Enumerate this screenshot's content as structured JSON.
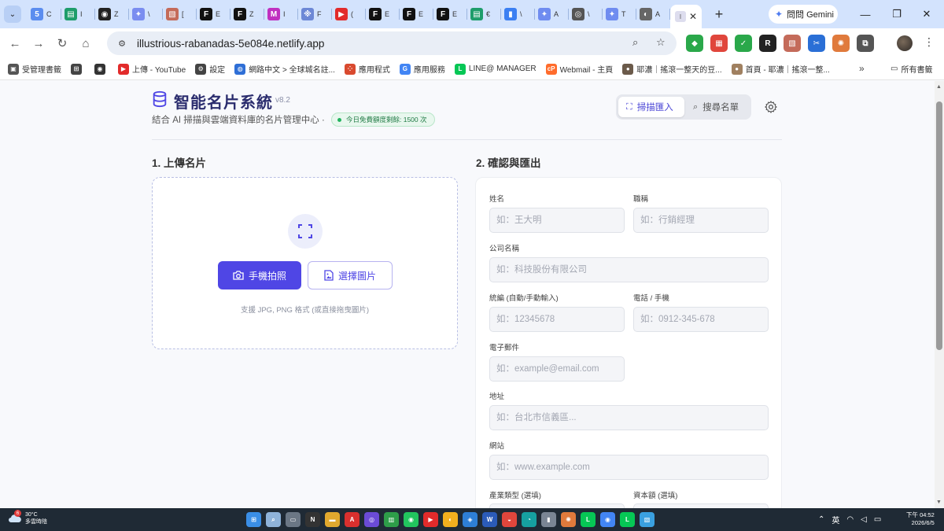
{
  "browser": {
    "mini_tabs": [
      {
        "fav": "5",
        "color": "#5b8def",
        "title": "C"
      },
      {
        "fav": "▤",
        "color": "#1e9d6b",
        "title": "I"
      },
      {
        "fav": "◉",
        "color": "#222222",
        "title": "Z"
      },
      {
        "fav": "✦",
        "color": "#7a8df0",
        "title": "\\"
      },
      {
        "fav": "▧",
        "color": "#c46b5a",
        "title": "["
      },
      {
        "fav": "F",
        "color": "#111111",
        "title": "E"
      },
      {
        "fav": "F",
        "color": "#111111",
        "title": "Z"
      },
      {
        "fav": "M",
        "color": "#c030c0",
        "title": "I"
      },
      {
        "fav": "※",
        "color": "#6d88d6",
        "title": "F"
      },
      {
        "fav": "▶",
        "color": "#e22b2b",
        "title": "("
      },
      {
        "fav": "F",
        "color": "#111111",
        "title": "E"
      },
      {
        "fav": "F",
        "color": "#111111",
        "title": "E"
      },
      {
        "fav": "F",
        "color": "#111111",
        "title": "E"
      },
      {
        "fav": "▤",
        "color": "#1e9d6b",
        "title": "€"
      },
      {
        "fav": "▮",
        "color": "#3b7ff2",
        "title": "\\"
      },
      {
        "fav": "✦",
        "color": "#6f8cf0",
        "title": "A"
      },
      {
        "fav": "◎",
        "color": "#555555",
        "title": "\\"
      },
      {
        "fav": "✦",
        "color": "#6f8cf0",
        "title": "T"
      },
      {
        "fav": "◐",
        "color": "#666666",
        "title": "A"
      }
    ],
    "active_tab_title": "I",
    "gemini_label": "問問 Gemini",
    "url": "illustrious-rabanadas-5e084e.netlify.app",
    "extensions": [
      {
        "glyph": "◆",
        "color": "#2aa84a"
      },
      {
        "glyph": "▦",
        "color": "#e0463c"
      },
      {
        "glyph": "✓",
        "color": "#2aa84a"
      },
      {
        "glyph": "R",
        "color": "#222222"
      },
      {
        "glyph": "▧",
        "color": "#c46b5a"
      },
      {
        "glyph": "✂",
        "color": "#2a6fd6"
      },
      {
        "glyph": "✺",
        "color": "#e07a3c"
      },
      {
        "glyph": "⧉",
        "color": "#555555"
      }
    ],
    "bookmarks": [
      {
        "label": "受管理書籤",
        "glyph": "▣",
        "color": "#555555"
      },
      {
        "label": "",
        "glyph": "⊞",
        "color": "#444444"
      },
      {
        "label": "",
        "glyph": "◉",
        "color": "#333333"
      },
      {
        "label": "上傳 - YouTube",
        "glyph": "▶",
        "color": "#e22b2b"
      },
      {
        "label": "設定",
        "glyph": "⚙",
        "color": "#444444"
      },
      {
        "label": "網路中文 > 全球城名註...",
        "glyph": "◍",
        "color": "#2f6fd6"
      },
      {
        "label": "應用程式",
        "glyph": "⁘",
        "color": "#d94a2f"
      },
      {
        "label": "應用服務",
        "glyph": "G",
        "color": "#4285f4"
      },
      {
        "label": "LINE@ MANAGER",
        "glyph": "L",
        "color": "#06c755"
      },
      {
        "label": "Webmail - 主頁",
        "glyph": "cP",
        "color": "#ff6c2c"
      },
      {
        "label": "耶濃｜搖滾一整天的豆...",
        "glyph": "●",
        "color": "#6b5a4a"
      },
      {
        "label": "首頁 - 耶濃｜搖滾一整...",
        "glyph": "●",
        "color": "#a08060"
      }
    ],
    "all_bookmarks": "所有書籤"
  },
  "app": {
    "title": "智能名片系統",
    "version": "v8.2",
    "subtitle": "結合 AI 掃描與雲端資料庫的名片管理中心 ·",
    "quota": "今日免費額度剩餘: 1500 次",
    "tabs": {
      "scan": "掃描匯入",
      "search": "搜尋名單"
    },
    "accent": "#4f46e5"
  },
  "upload": {
    "section_title": "1. 上傳名片",
    "camera_button": "手機拍照",
    "pick_button": "選擇圖片",
    "hint": "支援 JPG, PNG 格式 (或直接拖曳圖片)"
  },
  "form": {
    "section_title": "2. 確認與匯出",
    "fields": {
      "name": {
        "label": "姓名",
        "placeholder": "如：王大明",
        "value": ""
      },
      "job_title": {
        "label": "職稱",
        "placeholder": "如：行銷經理",
        "value": ""
      },
      "company": {
        "label": "公司名稱",
        "placeholder": "如：科技股份有限公司",
        "value": ""
      },
      "tax_id": {
        "label": "統編 (自動/手動輸入)",
        "placeholder": "如：12345678",
        "value": ""
      },
      "phone": {
        "label": "電話 / 手機",
        "placeholder": "如：0912-345-678",
        "value": ""
      },
      "email": {
        "label": "電子郵件",
        "placeholder": "如：example@email.com",
        "value": ""
      },
      "address": {
        "label": "地址",
        "placeholder": "如：台北市信義區...",
        "value": ""
      },
      "website": {
        "label": "網站",
        "placeholder": "如：www.example.com",
        "value": ""
      },
      "industry": {
        "label": "產業類型 (選填)",
        "placeholder": "",
        "value": ""
      },
      "capital": {
        "label": "資本額 (選填)",
        "placeholder": "",
        "value": ""
      }
    }
  },
  "taskbar": {
    "weather_badge": "6",
    "temperature": "30°C",
    "weather_text": "多雲時陰",
    "ime": "英",
    "time": "下午 04:52",
    "date": "2026/6/5",
    "apps": [
      {
        "glyph": "⊞",
        "color": "#3a8ee6"
      },
      {
        "glyph": "⌕",
        "color": "#8fb3d9"
      },
      {
        "glyph": "▭",
        "color": "#6b7785"
      },
      {
        "glyph": "N",
        "color": "#333333"
      },
      {
        "glyph": "▬",
        "color": "#e0a82e"
      },
      {
        "glyph": "A",
        "color": "#d9302e"
      },
      {
        "glyph": "◎",
        "color": "#6b4bd6"
      },
      {
        "glyph": "▥",
        "color": "#2e9d49"
      },
      {
        "glyph": "◉",
        "color": "#22c55e"
      },
      {
        "glyph": "▶",
        "color": "#e22b2b"
      },
      {
        "glyph": "◐",
        "color": "#f2b01e"
      },
      {
        "glyph": "◈",
        "color": "#2e7fd6"
      },
      {
        "glyph": "W",
        "color": "#2b5bb8"
      },
      {
        "glyph": "◒",
        "color": "#e0463c"
      },
      {
        "glyph": "◔",
        "color": "#16a0a0"
      },
      {
        "glyph": "▮",
        "color": "#7a8594"
      },
      {
        "glyph": "✺",
        "color": "#e07a3c"
      },
      {
        "glyph": "L",
        "color": "#06c755"
      },
      {
        "glyph": "◉",
        "color": "#4285f4"
      },
      {
        "glyph": "L",
        "color": "#06c755"
      },
      {
        "glyph": "▧",
        "color": "#3aa0e0"
      }
    ]
  }
}
